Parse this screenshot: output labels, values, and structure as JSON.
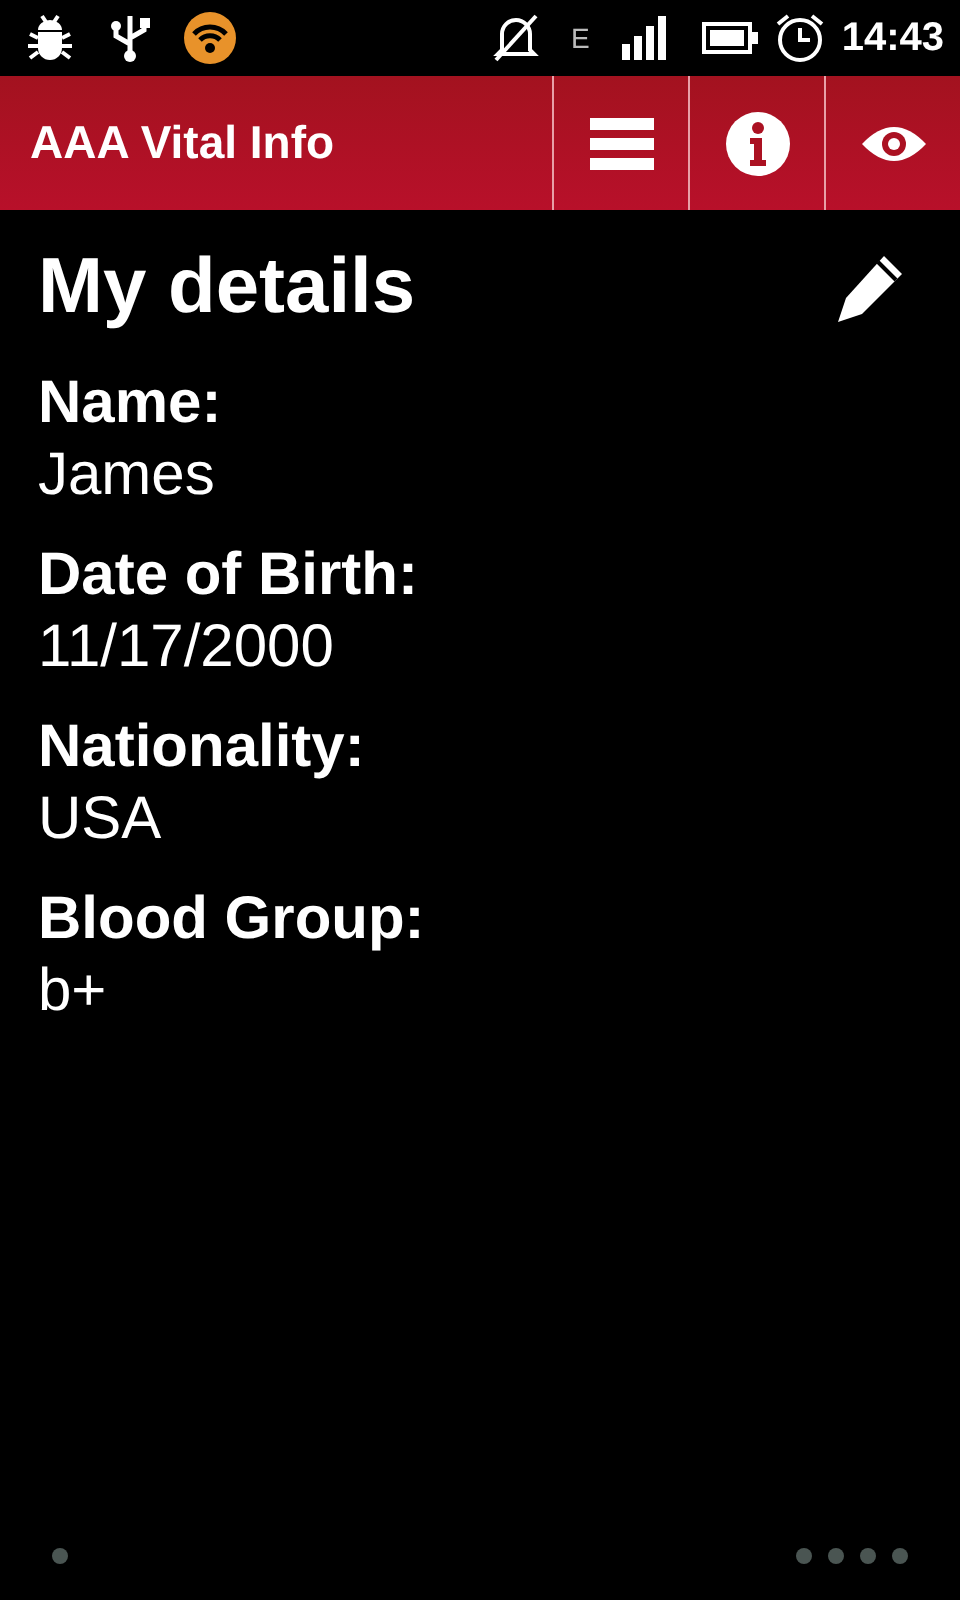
{
  "status_bar": {
    "time": "14:43",
    "data_type": "E"
  },
  "app_bar": {
    "title": "AAA Vital Info"
  },
  "page": {
    "heading": "My details"
  },
  "fields": [
    {
      "label": "Name:",
      "value": "James"
    },
    {
      "label": "Date of Birth:",
      "value": "11/17/2000"
    },
    {
      "label": "Nationality:",
      "value": "USA"
    },
    {
      "label": "Blood Group:",
      "value": "b+"
    }
  ]
}
